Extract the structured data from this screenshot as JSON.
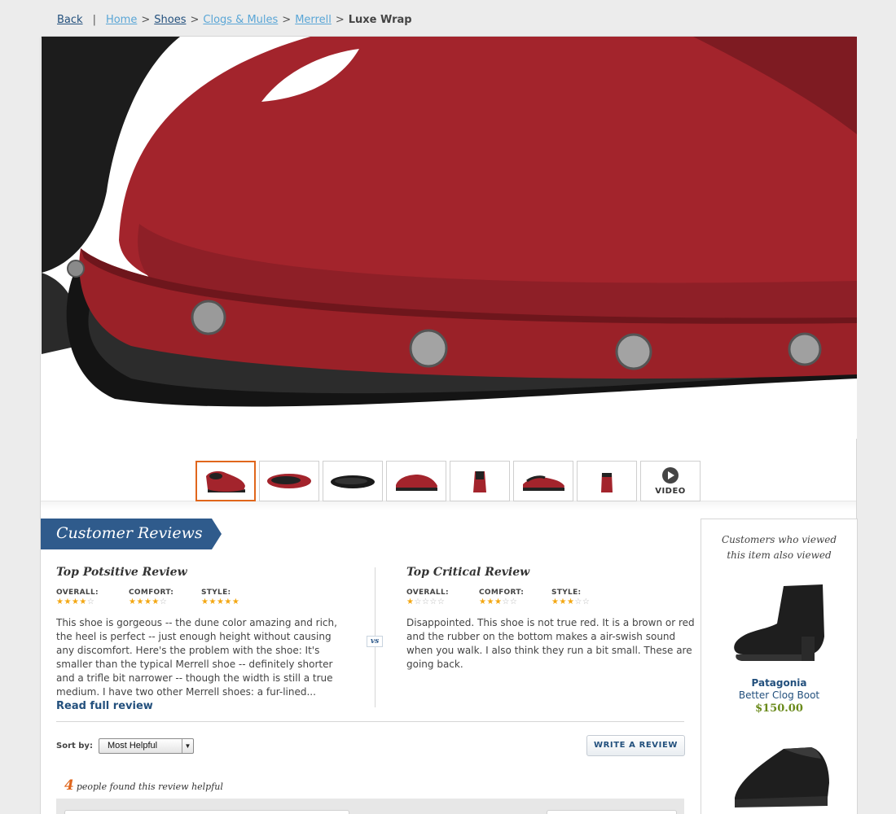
{
  "breadcrumb": {
    "back": "Back",
    "separator": "|",
    "gt": ">",
    "items": [
      "Home",
      "Shoes",
      "Clogs & Mules",
      "Merrell"
    ],
    "current": "Luxe Wrap"
  },
  "thumbnails": {
    "selected_index": 0,
    "count": 8,
    "video_label": "VIDEO"
  },
  "reviews": {
    "section_title": "Customer Reviews",
    "positive": {
      "title": "Top Potsitive Review",
      "overall_label": "OVERALL:",
      "comfort_label": "COMFORT:",
      "style_label": "STYLE:",
      "overall": 4,
      "comfort": 4,
      "style": 5,
      "text": "This shoe is gorgeous -- the dune color amazing and rich, the heel is perfect -- just enough height without causing any discomfort. Here's the problem with the shoe: It's smaller than the typical Merrell shoe -- definitely shorter and a trifle bit narrower -- though the width is still a true medium. I have two other Merrell shoes: a fur-lined...",
      "read_more": "Read full review"
    },
    "vs": "vs",
    "critical": {
      "title": "Top Critical Review",
      "overall_label": "OVERALL:",
      "comfort_label": "COMFORT:",
      "style_label": "STYLE:",
      "overall": 1,
      "comfort": 3,
      "style": 3,
      "text": "Disappointed. This shoe is not true red. It is a brown or red and the rubber on the bottom makes a air-swish sound when you walk. I also think they run a bit small. These are going back."
    },
    "sort_label": "Sort by:",
    "sort_value": "Most Helpful",
    "write_review": "WRITE A REVIEW",
    "helpful_count": "4",
    "helpful_text": "people found this review helpful"
  },
  "also_viewed": {
    "title_line1": "Customers who viewed",
    "title_line2": "this item also viewed",
    "items": [
      {
        "brand": "Patagonia",
        "name": "Better Clog Boot",
        "price": "$150.00"
      }
    ]
  },
  "colors": {
    "shoe": "#a3242c",
    "accent_orange": "#e0661c",
    "brand_blue": "#2f5b8c",
    "price_green": "#6a8a1b",
    "star": "#f3a712"
  }
}
